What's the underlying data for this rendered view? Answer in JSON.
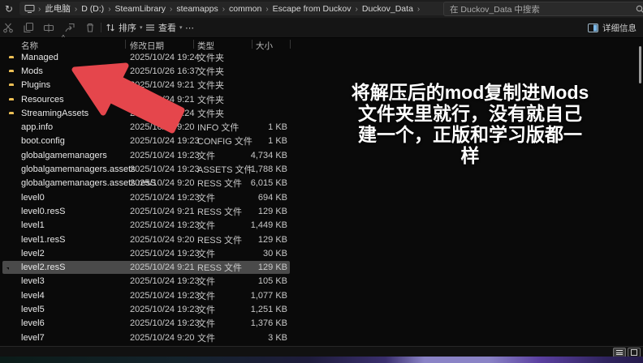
{
  "window": {
    "breadcrumb": {
      "items": [
        "此电脑",
        "D (D:)",
        "SteamLibrary",
        "steamapps",
        "common",
        "Escape from Duckov",
        "Duckov_Data"
      ]
    },
    "search": {
      "placeholder": "在 Duckov_Data 中搜索"
    },
    "toolbar": {
      "sort_label": "排序",
      "view_label": "查看",
      "details_label": "详细信息"
    },
    "columns": {
      "name": "名称",
      "date": "修改日期",
      "type": "类型",
      "size": "大小"
    },
    "rows": [
      {
        "name": "Managed",
        "date": "2025/10/24 19:24",
        "type": "文件夹",
        "size": "",
        "kind": "folder"
      },
      {
        "name": "Mods",
        "date": "2025/10/26 16:37",
        "type": "文件夹",
        "size": "",
        "kind": "folder"
      },
      {
        "name": "Plugins",
        "date": "2025/10/24 9:21",
        "type": "文件夹",
        "size": "",
        "kind": "folder"
      },
      {
        "name": "Resources",
        "date": "2025/10/24 9:21",
        "type": "文件夹",
        "size": "",
        "kind": "folder"
      },
      {
        "name": "StreamingAssets",
        "date": "2025/10/24 9:24",
        "type": "文件夹",
        "size": "",
        "kind": "folder"
      },
      {
        "name": "app.info",
        "date": "2025/10/24 9:20",
        "type": "INFO 文件",
        "size": "1 KB",
        "kind": "file"
      },
      {
        "name": "boot.config",
        "date": "2025/10/24 19:23",
        "type": "CONFIG 文件",
        "size": "1 KB",
        "kind": "file"
      },
      {
        "name": "globalgamemanagers",
        "date": "2025/10/24 19:23",
        "type": "文件",
        "size": "4,734 KB",
        "kind": "file"
      },
      {
        "name": "globalgamemanagers.assets",
        "date": "2025/10/24 19:23",
        "type": "ASSETS 文件",
        "size": "1,788 KB",
        "kind": "file"
      },
      {
        "name": "globalgamemanagers.assets.resS",
        "date": "2025/10/24 9:20",
        "type": "RESS 文件",
        "size": "6,015 KB",
        "kind": "file"
      },
      {
        "name": "level0",
        "date": "2025/10/24 19:23",
        "type": "文件",
        "size": "694 KB",
        "kind": "file"
      },
      {
        "name": "level0.resS",
        "date": "2025/10/24 9:21",
        "type": "RESS 文件",
        "size": "129 KB",
        "kind": "file"
      },
      {
        "name": "level1",
        "date": "2025/10/24 19:23",
        "type": "文件",
        "size": "1,449 KB",
        "kind": "file"
      },
      {
        "name": "level1.resS",
        "date": "2025/10/24 9:20",
        "type": "RESS 文件",
        "size": "129 KB",
        "kind": "file"
      },
      {
        "name": "level2",
        "date": "2025/10/24 19:23",
        "type": "文件",
        "size": "30 KB",
        "kind": "file"
      },
      {
        "name": "level2.resS",
        "date": "2025/10/24 9:21",
        "type": "RESS 文件",
        "size": "129 KB",
        "kind": "file",
        "selected": true
      },
      {
        "name": "level3",
        "date": "2025/10/24 19:23",
        "type": "文件",
        "size": "105 KB",
        "kind": "file"
      },
      {
        "name": "level4",
        "date": "2025/10/24 19:23",
        "type": "文件",
        "size": "1,077 KB",
        "kind": "file"
      },
      {
        "name": "level5",
        "date": "2025/10/24 19:23",
        "type": "文件",
        "size": "1,251 KB",
        "kind": "file"
      },
      {
        "name": "level6",
        "date": "2025/10/24 19:23",
        "type": "文件",
        "size": "1,376 KB",
        "kind": "file"
      },
      {
        "name": "level7",
        "date": "2025/10/24 9:20",
        "type": "文件",
        "size": "3 KB",
        "kind": "file"
      },
      {
        "name": "",
        "date": "",
        "type": "",
        "size": "",
        "kind": "file"
      }
    ]
  },
  "annotation": {
    "lines": [
      "将解压后的mod复制进Mods",
      "文件夹里就行，没有就自己",
      "建一个，正版和学习版都一",
      "样"
    ]
  },
  "icons": {
    "refresh": "↻",
    "more": "⋯",
    "caret": "▾",
    "sort_caret": "^",
    "crumb_sep": "›"
  },
  "colors": {
    "arrow": "#e5464c",
    "folder": "#eec14f",
    "selection": "#4a4a4a",
    "details_accent": "#7ab8e8"
  }
}
